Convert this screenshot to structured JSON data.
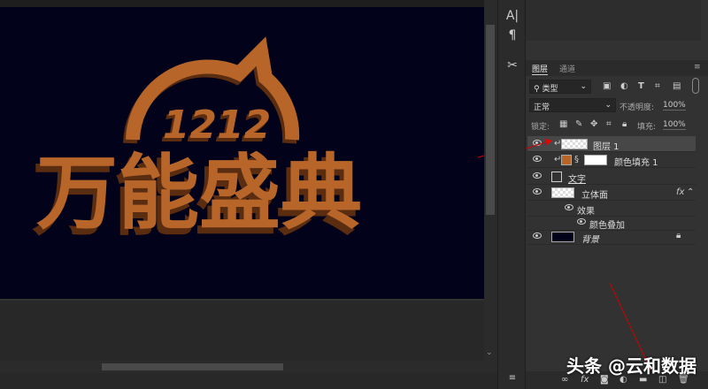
{
  "canvas": {
    "logo_top": "1212",
    "logo_main": "万能盛典",
    "background_color": "#02021a",
    "logo_color": "#b8652a"
  },
  "toolstrip": {
    "character_icon": "A|",
    "paragraph_icon": "¶",
    "tools_icon": "✂"
  },
  "layers_panel": {
    "tabs": [
      {
        "label": "图层",
        "active": true
      },
      {
        "label": "通道",
        "active": false
      }
    ],
    "filter": {
      "label": "类型",
      "icon": "search-icon"
    },
    "blend_mode": "正常",
    "opacity_label": "不透明度:",
    "opacity_value": "100%",
    "lock_label": "锁定:",
    "fill_label": "填充:",
    "fill_value": "100%",
    "layers": [
      {
        "name": "图层 1",
        "selected": true,
        "clipped": true
      },
      {
        "name": "颜色填充 1",
        "clipped": true,
        "fill_color": "#b8652a"
      },
      {
        "name": "文字"
      },
      {
        "name": "立体面",
        "fx": "fx"
      },
      {
        "name": "效果",
        "sub": true
      },
      {
        "name": "颜色叠加",
        "sub": true
      },
      {
        "name": "背景",
        "locked": true,
        "color": "#02021a"
      }
    ]
  },
  "watermark": "头条 @云和数据"
}
